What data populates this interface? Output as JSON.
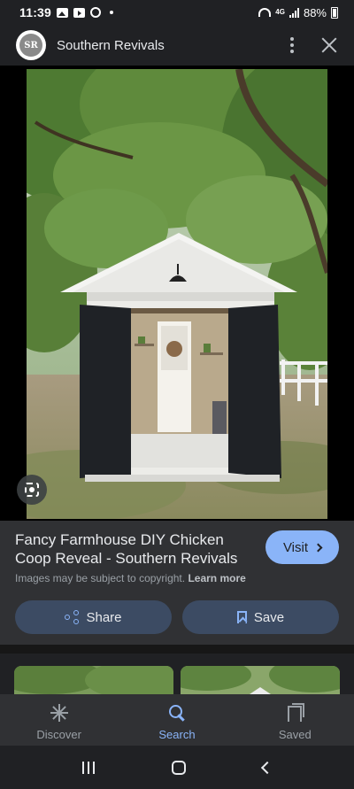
{
  "status_bar": {
    "time": "11:39",
    "network": "4G",
    "battery": "88%"
  },
  "header": {
    "avatar_initials": "SR",
    "site_name": "Southern Revivals",
    "more_icon": "more-vert-icon",
    "close_icon": "close-icon"
  },
  "image": {
    "lens_icon": "google-lens-icon"
  },
  "result": {
    "title": "Fancy Farmhouse DIY Chicken Coop Reveal - Southern Revivals",
    "visit_label": "Visit",
    "copyright_text": "Images may be subject to copyright.",
    "learn_more": "Learn more",
    "share_label": "Share",
    "save_label": "Save"
  },
  "bottom_nav": {
    "items": [
      {
        "label": "Discover",
        "icon": "asterisk-icon",
        "active": false
      },
      {
        "label": "Search",
        "icon": "search-icon",
        "active": true
      },
      {
        "label": "Saved",
        "icon": "bookmarks-icon",
        "active": false
      }
    ]
  },
  "colors": {
    "accent": "#8ab4f8",
    "surface": "#303134",
    "background": "#202124",
    "button": "#3c4b63"
  }
}
